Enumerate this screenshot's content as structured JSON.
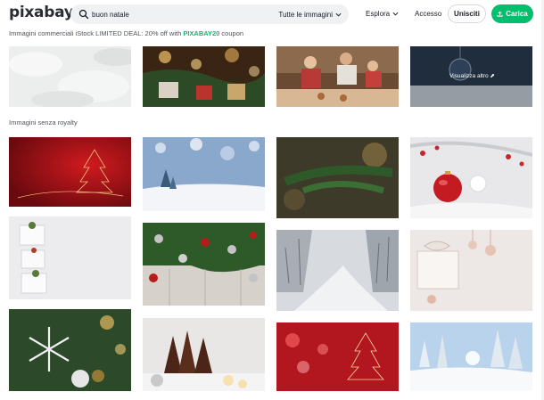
{
  "header": {
    "logo": "pixabay",
    "search": {
      "value": "buon natale",
      "placeholder": "buon natale",
      "filter": "Tutte le immagini"
    },
    "nav": {
      "explore": "Esplora",
      "login": "Accesso",
      "join": "Unisciti",
      "upload": "Carica"
    }
  },
  "promo": {
    "text": "Immagini commerciali iStock LIMITED DEAL: 20% off with ",
    "code": "PIXABAY20",
    "suffix": " coupon"
  },
  "sponsored": {
    "overlay": "Visualizza altro ⬈"
  },
  "section": {
    "title": "Immagini senza royalty"
  },
  "colors": {
    "brand": "#02be6e",
    "text": "#191b26",
    "muted": "#4f5260"
  }
}
